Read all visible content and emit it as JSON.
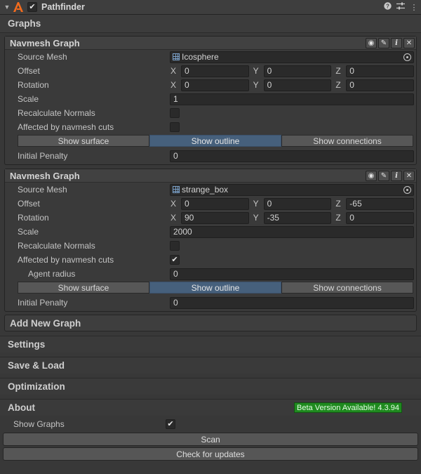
{
  "window": {
    "title": "Pathfinder",
    "enabled": true,
    "icons": [
      "help-icon",
      "sliders-icon",
      "more-vertical-icon"
    ]
  },
  "graphs_section": {
    "label": "Graphs"
  },
  "graphs": [
    {
      "title": "Navmesh Graph",
      "tools": [
        "eye-icon",
        "pencil-icon",
        "info-icon",
        "close-icon"
      ],
      "tool_glyphs": [
        "◉",
        "✎",
        "i",
        "✕"
      ],
      "source_mesh_label": "Source Mesh",
      "source_mesh": "Icosphere",
      "offset_label": "Offset",
      "offset": {
        "x": "0",
        "y": "0",
        "z": "0"
      },
      "rotation_label": "Rotation",
      "rotation": {
        "x": "0",
        "y": "0",
        "z": "0"
      },
      "scale_label": "Scale",
      "scale": "1",
      "recalc_label": "Recalculate Normals",
      "recalc": false,
      "cuts_label": "Affected by navmesh cuts",
      "cuts": false,
      "show_surface": "Show surface",
      "show_outline": "Show outline",
      "show_connections": "Show connections",
      "penalty_label": "Initial Penalty",
      "penalty": "0"
    },
    {
      "title": "Navmesh Graph",
      "tools": [
        "eye-icon",
        "pencil-icon",
        "info-icon",
        "close-icon"
      ],
      "tool_glyphs": [
        "◉",
        "✎",
        "i",
        "✕"
      ],
      "source_mesh_label": "Source Mesh",
      "source_mesh": "strange_box",
      "offset_label": "Offset",
      "offset": {
        "x": "0",
        "y": "0",
        "z": "-65"
      },
      "rotation_label": "Rotation",
      "rotation": {
        "x": "90",
        "y": "-35",
        "z": "0"
      },
      "scale_label": "Scale",
      "scale": "2000",
      "recalc_label": "Recalculate Normals",
      "recalc": false,
      "cuts_label": "Affected by navmesh cuts",
      "cuts": true,
      "agent_radius_label": "Agent radius",
      "agent_radius": "0",
      "show_surface": "Show surface",
      "show_outline": "Show outline",
      "show_connections": "Show connections",
      "penalty_label": "Initial Penalty",
      "penalty": "0"
    }
  ],
  "axes": {
    "x": "X",
    "y": "Y",
    "z": "Z"
  },
  "add_graph": "Add New Graph",
  "sections": {
    "settings": "Settings",
    "save_load": "Save & Load",
    "optimization": "Optimization",
    "about": "About"
  },
  "beta_badge": "Beta Version Available! 4.3.94",
  "show_graphs_label": "Show Graphs",
  "show_graphs": true,
  "buttons": {
    "scan": "Scan",
    "check_updates": "Check for updates"
  },
  "colors": {
    "background": "#383838",
    "active_toggle": "#46607c",
    "beta_badge": "#1f8a1f"
  }
}
